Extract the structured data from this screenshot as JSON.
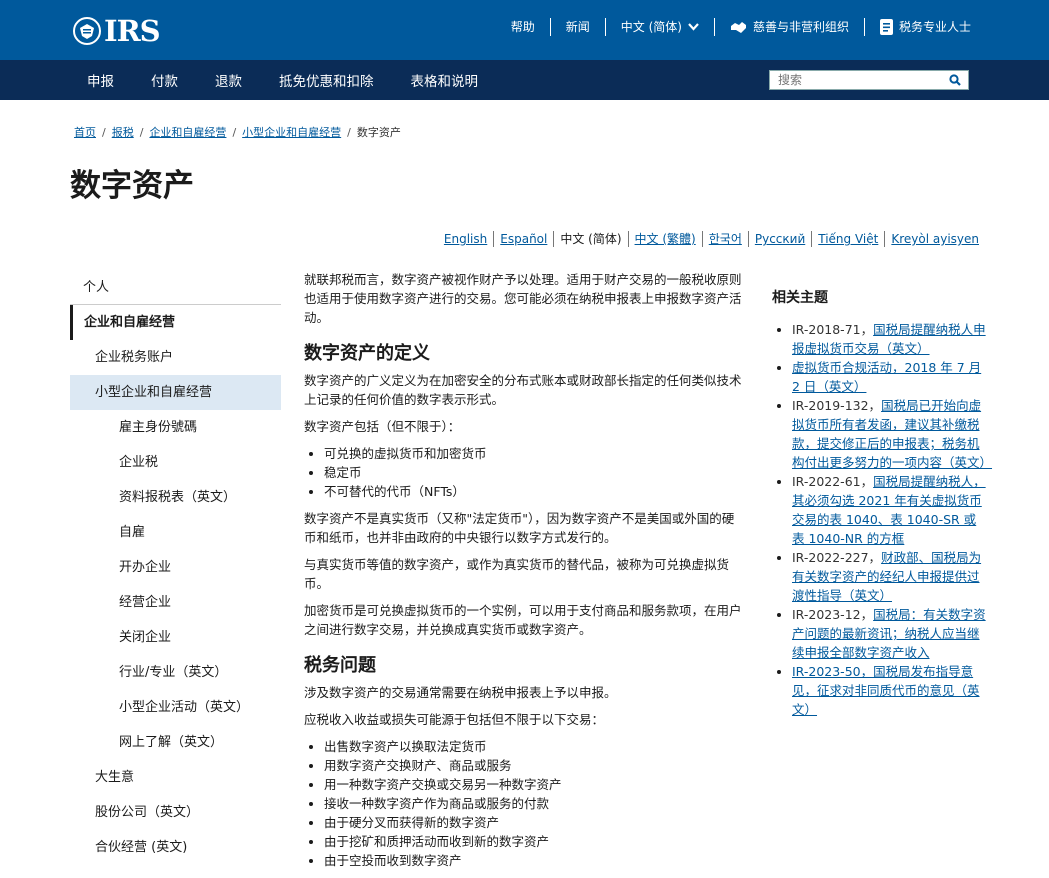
{
  "header": {
    "logo_text": "IRS",
    "top_links": [
      {
        "label": "帮助",
        "icon": ""
      },
      {
        "label": "新闻",
        "icon": ""
      },
      {
        "label": "中文 (简体)",
        "icon": "chevron-down-icon"
      },
      {
        "label": "慈善与非营利组织",
        "icon": "handshake-icon"
      },
      {
        "label": "税务专业人士",
        "icon": "document-icon"
      }
    ],
    "nav": [
      "申报",
      "付款",
      "退款",
      "抵免优惠和扣除",
      "表格和说明"
    ],
    "search_placeholder": "搜索"
  },
  "breadcrumb": {
    "items": [
      "首页",
      "报税",
      "企业和自雇经营",
      "小型企业和自雇经营"
    ],
    "current": "数字资产"
  },
  "page_title": "数字资产",
  "languages": [
    {
      "label": "English",
      "active": false
    },
    {
      "label": "Español",
      "active": false
    },
    {
      "label": "中文 (简体)",
      "active": true
    },
    {
      "label": "中文 (繁體)",
      "active": false
    },
    {
      "label": "한국어",
      "active": false
    },
    {
      "label": "Русский",
      "active": false
    },
    {
      "label": "Tiếng Việt",
      "active": false
    },
    {
      "label": "Kreyòl ayisyen",
      "active": false
    }
  ],
  "sidenav": {
    "individual": "个人",
    "business": "企业和自雇经营",
    "biz_account": "企业税务账户",
    "small_business": "小型企业和自雇经营",
    "sub_items": [
      "雇主身份號碼",
      "企业税",
      "资料报税表（英文）",
      "自雇",
      "开办企业",
      "经营企业",
      "关闭企业",
      "行业/专业（英文）",
      "小型企业活动（英文）",
      "网上了解（英文）"
    ],
    "large_business": "大生意",
    "corporations": "股份公司（英文）",
    "partnerships": "合伙经营 (英文)"
  },
  "main": {
    "intro": "就联邦税而言，数字资产被视作财产予以处理。适用于财产交易的一般税收原则也适用于使用数字资产进行的交易。您可能必须在纳税申报表上申报数字资产活动。",
    "h_definition": "数字资产的定义",
    "def_p1": "数字资产的广义定义为在加密安全的分布式账本或财政部长指定的任何类似技术上记录的任何价值的数字表示形式。",
    "def_p2": "数字资产包括（但不限于）：",
    "def_list": [
      "可兑换的虚拟货币和加密货币",
      "稳定币",
      "不可替代的代币（NFTs）"
    ],
    "def_p3": "数字资产不是真实货币（又称\"法定货币\"），因为数字资产不是美国或外国的硬币和纸币，也并非由政府的中央银行以数字方式发行的。",
    "def_p4": "与真实货币等值的数字资产，或作为真实货币的替代品，被称为可兑换虚拟货币。",
    "def_p5": "加密货币是可兑换虚拟货币的一个实例，可以用于支付商品和服务款项，在用户之间进行数字交易，并兑换成真实货币或数字资产。",
    "h_tax": "税务问题",
    "tax_p1": "涉及数字资产的交易通常需要在纳税申报表上予以申报。",
    "tax_p2": "应税收入收益或损失可能源于包括但不限于以下交易：",
    "tax_list": [
      "出售数字资产以换取法定货币",
      "用数字资产交换财产、商品或服务",
      "用一种数字资产交换或交易另一种数字资产",
      "接收一种数字资产作为商品或服务的付款",
      "由于硬分叉而获得新的数字资产",
      "由于挖矿和质押活动而收到新的数字资产",
      "由于空投而收到数字资产"
    ]
  },
  "related": {
    "heading": "相关主题",
    "items": [
      {
        "prefix": "IR-2018-71，",
        "link": "国税局提醒纳税人申报虚拟货币交易（英文）"
      },
      {
        "prefix": "",
        "link": "虚拟货币合规活动，2018 年 7 月 2 日（英文）"
      },
      {
        "prefix": "IR-2019-132，",
        "link": "国税局已开始向虚拟货币所有者发函，建议其补缴税款，提交修正后的申报表；税务机构付出更多努力的一项内容（英文）"
      },
      {
        "prefix": "IR-2022-61，",
        "link": "国税局提醒纳税人，其必须勾选 2021 年有关虚拟货币交易的表 1040、表 1040-SR 或表 1040-NR 的方框"
      },
      {
        "prefix": "IR-2022-227，",
        "link": "财政部、国税局为有关数字资产的经纪人申报提供过渡性指导（英文）"
      },
      {
        "prefix": "IR-2023-12，",
        "link": "国税局：有关数字资产问题的最新资讯；纳税人应当继续申报全部数字资产收入"
      },
      {
        "prefix": "",
        "link": "IR-2023-50，国税局发布指导意见，征求对非同质代币的意见（英文）"
      }
    ]
  },
  "colors": {
    "primary_blue": "#00599c",
    "nav_dark": "#0b2c57",
    "highlight": "#dce8f3"
  }
}
